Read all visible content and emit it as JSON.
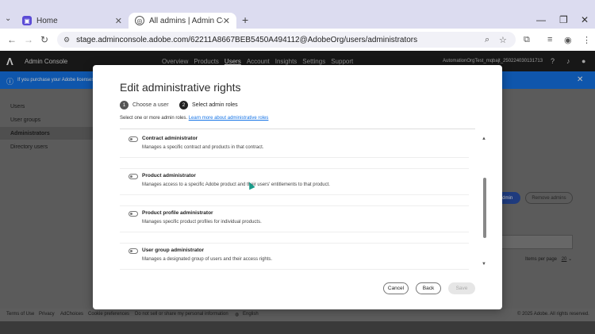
{
  "browser": {
    "tabs": [
      {
        "label": "Home",
        "active": false
      },
      {
        "label": "All admins | Admin Console",
        "active": true
      }
    ],
    "url": "stage.adminconsole.adobe.com/62211A8667BEB5450A494112@AdobeOrg/users/administrators"
  },
  "app": {
    "name": "Admin Console",
    "menu": [
      "Overview",
      "Products",
      "Users",
      "Account",
      "Insights",
      "Settings",
      "Support"
    ],
    "current_menu": "Users",
    "org_label": "AutomationOrgTest_mqbajt_250224030131713"
  },
  "banner": {
    "text": "If you purchase your Adobe licenses"
  },
  "sidebar": {
    "items": [
      "Users",
      "User groups",
      "Administrators",
      "Directory users"
    ],
    "selected": "Administrators"
  },
  "background": {
    "add_label": "admin",
    "remove_label": "Remove admins",
    "items_per_page_label": "Items per page",
    "items_per_page_value": "20"
  },
  "modal": {
    "title": "Edit administrative rights",
    "steps": [
      {
        "num": "1",
        "label": "Choose a user"
      },
      {
        "num": "2",
        "label": "Select admin roles"
      }
    ],
    "instruction": "Select one or more admin roles.",
    "learn_more": "Learn more about administrative roles",
    "roles": [
      {
        "name": "Contract administrator",
        "desc": "Manages a specific contract and products in that contract."
      },
      {
        "name": "Product administrator",
        "desc": "Manages access to a specific Adobe product and their users' entitlements to that product."
      },
      {
        "name": "Product profile administrator",
        "desc": "Manages specific product profiles for individual products."
      },
      {
        "name": "User group administrator",
        "desc": "Manages a designated group of users and their access rights."
      }
    ],
    "buttons": {
      "cancel": "Cancel",
      "back": "Back",
      "save": "Save"
    }
  },
  "footer": {
    "links": [
      "Terms of Use",
      "Privacy",
      "AdChoices",
      "Cookie preferences",
      "Do not sell or share my personal information"
    ],
    "language": "English",
    "copyright": "© 2025 Adobe. All rights reserved."
  }
}
